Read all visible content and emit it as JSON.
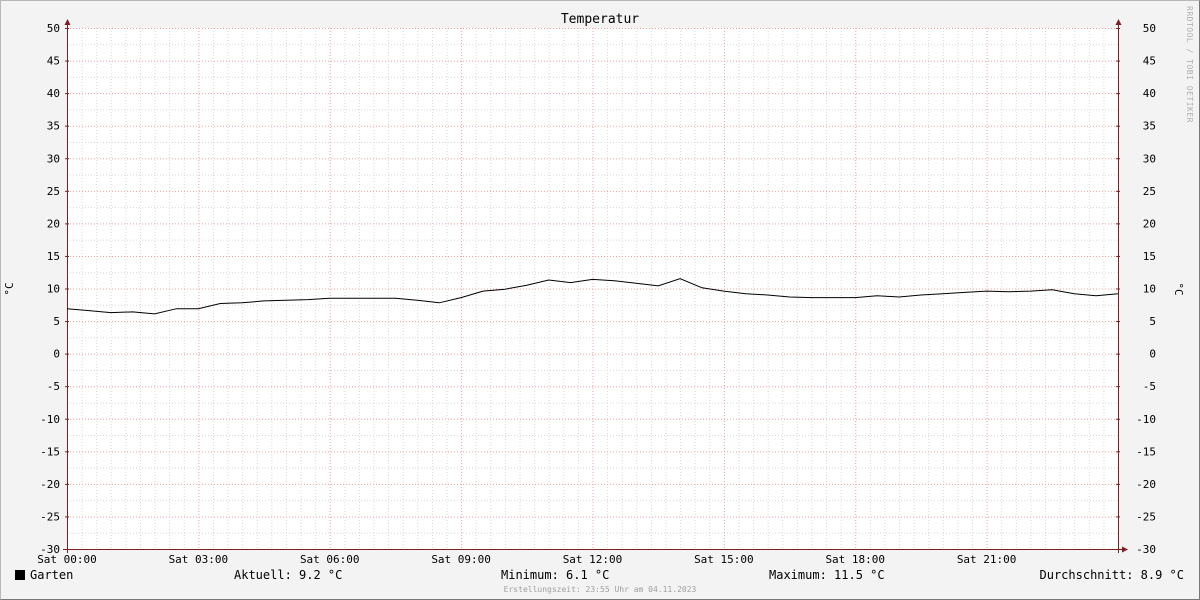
{
  "chart_data": {
    "type": "line",
    "title": "Temperatur",
    "ylabel": "°C",
    "ylim": [
      -30,
      50
    ],
    "yticks": [
      50,
      45,
      40,
      35,
      30,
      25,
      20,
      15,
      10,
      5,
      0,
      -5,
      -10,
      -15,
      -20,
      -25,
      -30
    ],
    "xlim": [
      "Sat 00:00",
      "Sat 24:00"
    ],
    "xtick_labels": [
      "Sat 00:00",
      "Sat 03:00",
      "Sat 06:00",
      "Sat 09:00",
      "Sat 12:00",
      "Sat 15:00",
      "Sat 18:00",
      "Sat 21:00"
    ],
    "grid": true,
    "series": [
      {
        "name": "Garten",
        "color": "#000000",
        "x_hours": [
          0,
          0.5,
          1,
          1.5,
          2,
          2.5,
          3,
          3.5,
          4,
          4.5,
          5,
          5.5,
          6,
          6.5,
          7,
          7.5,
          8,
          8.5,
          9,
          9.5,
          10,
          10.5,
          11,
          11.5,
          12,
          12.5,
          13,
          13.5,
          14,
          14.5,
          15,
          15.5,
          16,
          16.5,
          17,
          17.5,
          18,
          18.5,
          19,
          19.5,
          20,
          20.5,
          21,
          21.5,
          22,
          22.5,
          23,
          23.5,
          24
        ],
        "values": [
          6.9,
          6.6,
          6.3,
          6.4,
          6.1,
          6.9,
          6.9,
          7.7,
          7.8,
          8.1,
          8.2,
          8.3,
          8.5,
          8.5,
          8.5,
          8.5,
          8.2,
          7.8,
          8.6,
          9.6,
          9.9,
          10.5,
          11.3,
          10.9,
          11.4,
          11.2,
          10.8,
          10.4,
          11.5,
          10.1,
          9.6,
          9.2,
          9.0,
          8.7,
          8.6,
          8.6,
          8.6,
          8.9,
          8.7,
          9.0,
          9.2,
          9.4,
          9.6,
          9.5,
          9.6,
          9.8,
          9.2,
          8.9,
          9.2
        ]
      }
    ]
  },
  "legend": {
    "label": "Garten"
  },
  "stats": {
    "current": "Aktuell: 9.2 °C",
    "minimum": "Minimum: 6.1 °C",
    "maximum": "Maximum: 11.5 °C",
    "average": "Durchschnitt: 8.9 °C"
  },
  "created": "Erstellungszeit: 23:55 Uhr am 04.11.2023",
  "credit": "RRDTOOL / TOBI OETIKER",
  "colors": {
    "minor_grid": "#d8d8d8",
    "major_grid": "#f0a0a0",
    "axis": "#7a2020",
    "line": "#000000"
  }
}
